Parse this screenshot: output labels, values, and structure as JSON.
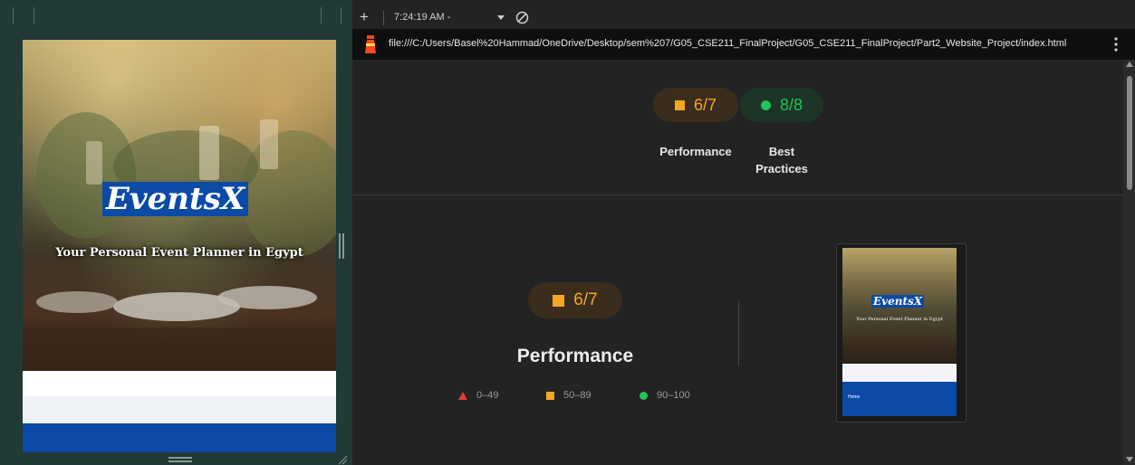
{
  "device_preview": {
    "logo": "EventsX",
    "tagline": "Your Personal Event Planner in Egypt"
  },
  "devtools": {
    "toolbar": {
      "add_label": "+",
      "timestamp": "7:24:19 AM -",
      "dropdown_icon": "caret-down-icon",
      "clear_icon": "block-icon"
    },
    "url": "file:///C:/Users/Basel%20Hammad/OneDrive/Desktop/sem%207/G05_CSE211_FinalProject/G05_CSE211_FinalProject/Part2_Website_Project/index.html",
    "summary": {
      "performance_score": "6/7",
      "performance_label": "Performance",
      "best_practices_score": "8/8",
      "best_practices_label_line1": "Best",
      "best_practices_label_line2": "Practices"
    },
    "detail": {
      "score": "6/7",
      "title": "Performance",
      "legend": [
        {
          "range": "0–49",
          "color": "#e53935"
        },
        {
          "range": "50–89",
          "color": "#f6a623"
        },
        {
          "range": "90–100",
          "color": "#1fc45a"
        }
      ]
    },
    "thumbnail": {
      "logo": "EventsX",
      "tagline": "Your Personal Event Planner in Egypt",
      "nav_item": "Home"
    }
  },
  "colors": {
    "average": "#f6a623",
    "pass": "#1fc45a",
    "fail": "#e53935",
    "brand_blue": "#0b4aa6"
  }
}
